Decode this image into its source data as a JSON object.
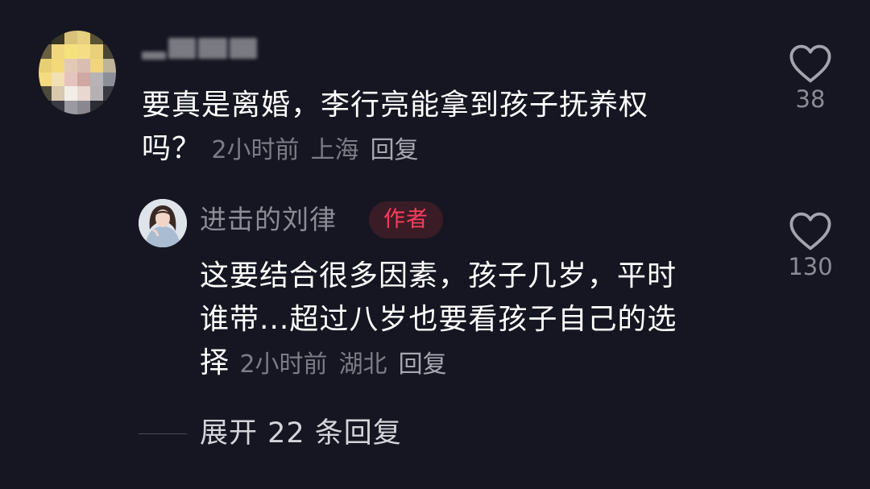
{
  "comment": {
    "text_line1": "要真是离婚，李行亮能拿到孩子抚养权",
    "text_line2": "吗？",
    "time": "2小时前",
    "location": "上海",
    "reply_label": "回复",
    "likes": "38"
  },
  "reply": {
    "author_name": "进击的刘律",
    "author_tag": "作者",
    "text_line1": "这要结合很多因素，孩子几岁，平时",
    "text_line2": "谁带...超过八岁也要看孩子自己的选",
    "text_line3": "择",
    "time": "2小时前",
    "location": "湖北",
    "reply_label": "回复",
    "likes": "130"
  },
  "expand": {
    "label": "展开 22 条回复"
  },
  "icons": {
    "like": "heart-outline-icon"
  },
  "colors": {
    "background": "#161622",
    "author_tag_text": "#ff3b5c",
    "author_tag_bg": "#3a1c26"
  }
}
